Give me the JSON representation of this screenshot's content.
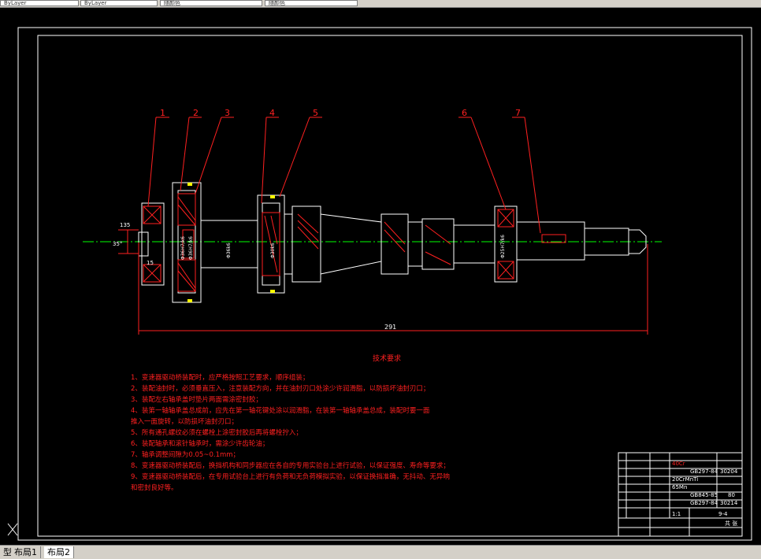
{
  "toolbar": {
    "field1": "ByLayer",
    "field2": "ByLayer",
    "field3": "随颜色"
  },
  "drawing": {
    "part_numbers": [
      "1",
      "2",
      "3",
      "4",
      "5",
      "6",
      "7"
    ],
    "dim_overall": "291",
    "dim_small": "135",
    "dim_side": "15",
    "dim_angle": "35°",
    "shaft_dim_1": "Φ36H7/k6",
    "shaft_dim_2": "Φ36k6",
    "shaft_dim_3": "Φ30k6",
    "shaft_dim_4": "Φ36H7/k6",
    "shaft_dim_5": "Φ25H7/k6"
  },
  "requirements": {
    "title": "技术要求",
    "items": [
      "1、变速器驱动桥装配时，应严格按照工艺要求，顺序组装；",
      "2、装配油封时，必须垂直压入，注意装配方向，并在油封刃口处涂少许润滑脂，以防损坏油封刃口；",
      "3、装配左右轴承盖时垫片两面需涂密封胶；",
      "4、装第一轴轴承盖总成前，应先在第一轴花键处涂以润滑脂，在装第一轴轴承盖总成，装配时要一面",
      "   推入一面旋转，以防损坏油封刃口；",
      "5、所有通孔螺纹必须在螺栓上涂密封胶后再将螺栓拧入；",
      "6、装配轴承和滚针轴承时，需涂少许齿轮油；",
      "7、轴承调整间隙为0.05~0.1mm；",
      "8、变速器驱动桥装配后，换挡机构和同步器应在各自的专用实验台上进行试验，以保证强度、寿命等要求；",
      "9、变速器驱动桥装配后，在专用试验台上进行有负荷和无负荷模拟实验，以保证换挡准确，无抖动、无异响",
      "   和密封良好等。"
    ]
  },
  "titleblock": {
    "std1": "GB297-84",
    "std1_code": "30204",
    "std2": "GB845-85",
    "std2_code": "80",
    "std3": "GB297-84",
    "std3_code": "30214",
    "mat1": "40Cr",
    "mat2": "20CrMnTi",
    "mat3": "65Mn",
    "scale": "1:1",
    "sheet": "9-4",
    "qty_label": "共 张"
  },
  "tabs": [
    "型",
    "布局1",
    "布局2"
  ],
  "colors": {
    "red": "#ff2020",
    "white": "#ffffff",
    "green": "#00ff00",
    "cyan": "#00ffff",
    "magenta": "#ff00ff"
  }
}
